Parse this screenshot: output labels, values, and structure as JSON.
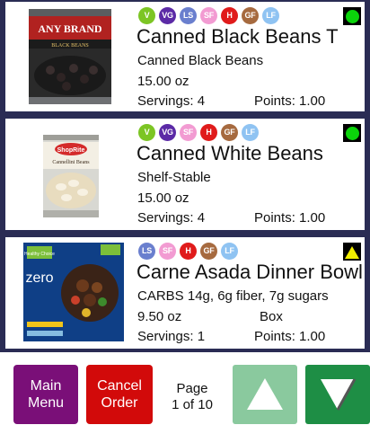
{
  "products": [
    {
      "badges": [
        "V",
        "VG",
        "LS",
        "SF",
        "H",
        "GF",
        "LF"
      ],
      "status": "green",
      "name": "Canned Black Beans T",
      "subtitle": "Canned Black Beans",
      "size": "15.00 oz",
      "unit": "",
      "servings": "Servings: 4",
      "points": "Points: 1.00",
      "image": {
        "brand": "ANY BRAND",
        "label": "BLACK BEANS"
      }
    },
    {
      "badges": [
        "V",
        "VG",
        "SF",
        "H",
        "GF",
        "LF"
      ],
      "status": "green",
      "name": "Canned White Beans",
      "subtitle": "Shelf-Stable",
      "size": "15.00 oz",
      "unit": "",
      "servings": "Servings: 4",
      "points": "Points: 1.00",
      "image": {
        "brand": "ShopRite",
        "label": "Cannellini Beans"
      }
    },
    {
      "badges": [
        "LS",
        "SF",
        "H",
        "GF",
        "LF"
      ],
      "status": "yellow",
      "name": "Carne Asada Dinner Bowl",
      "subtitle": "CARBS 14g, 6g fiber, 7g sugars",
      "size": "9.50 oz",
      "unit": "Box",
      "servings": "Servings: 1",
      "points": "Points: 1.00",
      "image": {
        "brand": "Healthy Choice",
        "label": "zero"
      }
    }
  ],
  "badge_colors": {
    "V": "#7cc524",
    "VG": "#5b2aa6",
    "LS": "#6a7fce",
    "SF": "#f29bd2",
    "H": "#e01b1b",
    "GF": "#a66a3f",
    "LF": "#8fc3f2"
  },
  "status_colors": {
    "green": "#0bd40b",
    "yellow": "#f2ee00"
  },
  "toolbar": {
    "main_menu": [
      "Main",
      "Menu"
    ],
    "cancel_order": [
      "Cancel",
      "Order"
    ],
    "page_label": "Page",
    "page_value": "1 of 10"
  },
  "icons": {
    "up": "triangle-up-icon",
    "down": "triangle-down-icon"
  }
}
